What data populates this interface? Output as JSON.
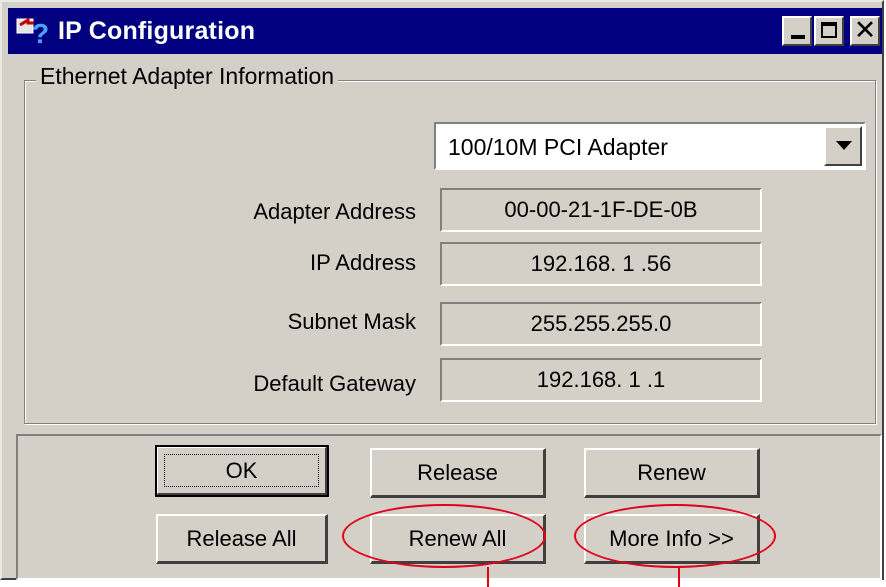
{
  "window": {
    "title": "IP Configuration",
    "icon": "ip-config-icon",
    "controls": [
      "minimize-icon",
      "maximize-icon",
      "close-icon"
    ],
    "close_glyph": "✕"
  },
  "group": {
    "legend": "Ethernet  Adapter Information",
    "adapter_select": "100/10M PCI Adapter",
    "fields": [
      {
        "label": "Adapter Address",
        "value": "00-00-21-1F-DE-0B"
      },
      {
        "label": "IP Address",
        "value": "192.168. 1 .56"
      },
      {
        "label": "Subnet Mask",
        "value": "255.255.255.0"
      },
      {
        "label": "Default Gateway",
        "value": "192.168. 1 .1"
      }
    ]
  },
  "buttons": {
    "ok": "OK",
    "release": "Release",
    "renew": "Renew",
    "release_all": "Release All",
    "renew_all": "Renew All",
    "more_info": "More Info >>"
  },
  "annotation_color": "#e0001a"
}
